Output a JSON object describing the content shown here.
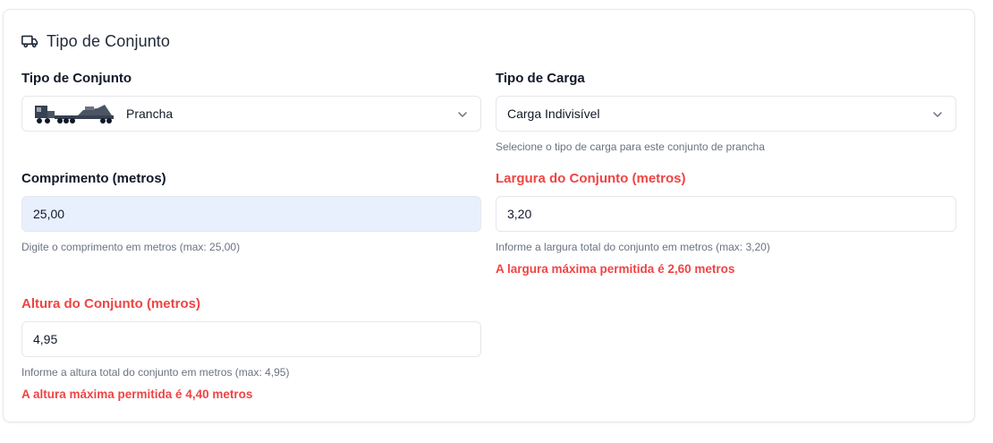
{
  "section": {
    "title": "Tipo de Conjunto",
    "icon": "truck-icon"
  },
  "tipo_conjunto": {
    "label": "Tipo de Conjunto",
    "value": "Prancha",
    "image": "truck-lowboy-image"
  },
  "tipo_carga": {
    "label": "Tipo de Carga",
    "value": "Carga Indivisível",
    "hint": "Selecione o tipo de carga para este conjunto de prancha"
  },
  "comprimento": {
    "label": "Comprimento (metros)",
    "value": "25,00",
    "hint": "Digite o comprimento em metros (max: 25,00)"
  },
  "largura": {
    "label": "Largura do Conjunto (metros)",
    "value": "3,20",
    "hint": "Informe a largura total do conjunto em metros (max: 3,20)",
    "error": "A largura máxima permitida é 2,60 metros"
  },
  "altura": {
    "label": "Altura do Conjunto (metros)",
    "value": "4,95",
    "hint": "Informe a altura total do conjunto em metros (max: 4,95)",
    "error": "A altura máxima permitida é 4,40 metros"
  },
  "colors": {
    "error": "#ef4444",
    "autofill_bg": "#e8f0fe",
    "border": "#e5e7eb",
    "hint": "#6b7280"
  }
}
